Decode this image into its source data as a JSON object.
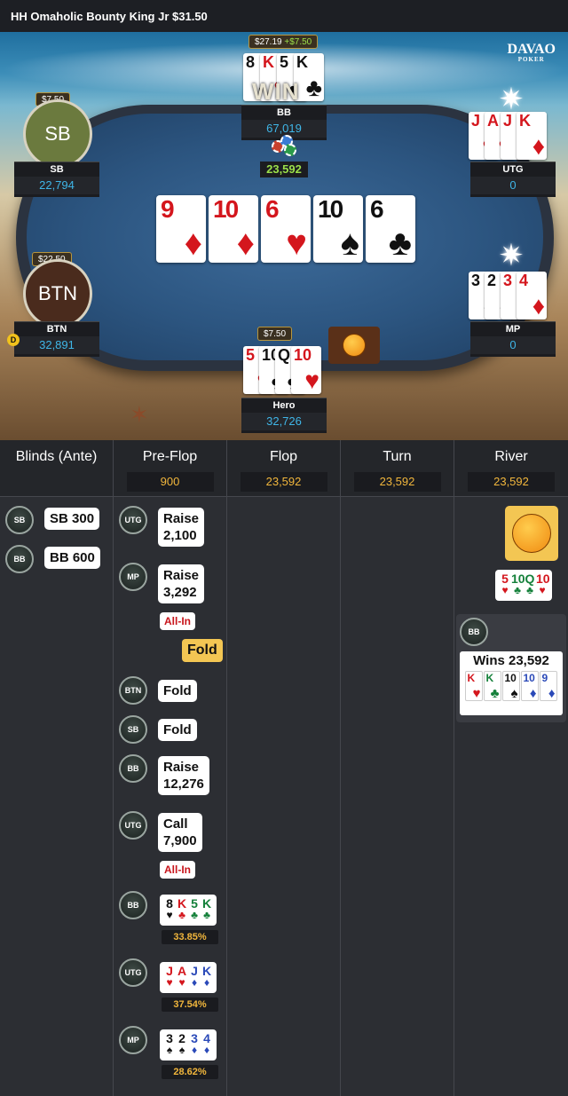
{
  "header": {
    "title": "HH  Omaholic Bounty King Jr $31.50"
  },
  "logo": {
    "name": "DAVAO",
    "sub": "POKER"
  },
  "table": {
    "pot": "23,592",
    "win_label": "WIN",
    "board": [
      {
        "rank": "9",
        "suit": "♦",
        "color": "red"
      },
      {
        "rank": "10",
        "suit": "♦",
        "color": "red"
      },
      {
        "rank": "6",
        "suit": "♥",
        "color": "red"
      },
      {
        "rank": "10",
        "suit": "♠",
        "color": "blk"
      },
      {
        "rank": "6",
        "suit": "♣",
        "color": "blk"
      }
    ],
    "dealer": "D"
  },
  "players": {
    "sb": {
      "avatar": "SB",
      "name": "SB",
      "stack": "22,794",
      "bounty": "$7.50"
    },
    "btn": {
      "avatar": "BTN",
      "name": "BTN",
      "stack": "32,891",
      "bounty": "$22.50"
    },
    "bb": {
      "name": "BB",
      "stack": "67,019",
      "bounty": "$27.19",
      "bounty_gain": "+$7.50",
      "cards": [
        {
          "rank": "8",
          "suit": "♠",
          "color": "blk"
        },
        {
          "rank": "K",
          "suit": "♥",
          "color": "red"
        },
        {
          "rank": "5",
          "suit": "♣",
          "color": "blk"
        },
        {
          "rank": "K",
          "suit": "♣",
          "color": "blk"
        }
      ]
    },
    "utg": {
      "name": "UTG",
      "stack": "0",
      "cards": [
        {
          "rank": "J",
          "suit": "♥",
          "color": "red"
        },
        {
          "rank": "A",
          "suit": "♥",
          "color": "red"
        },
        {
          "rank": "J",
          "suit": "♦",
          "color": "red"
        },
        {
          "rank": "K",
          "suit": "♦",
          "color": "red"
        }
      ]
    },
    "mp": {
      "name": "MP",
      "stack": "0",
      "cards": [
        {
          "rank": "3",
          "suit": "♠",
          "color": "blk"
        },
        {
          "rank": "2",
          "suit": "♠",
          "color": "blk"
        },
        {
          "rank": "3",
          "suit": "♦",
          "color": "red"
        },
        {
          "rank": "4",
          "suit": "♦",
          "color": "red"
        }
      ]
    },
    "hero": {
      "name": "Hero",
      "stack": "32,726",
      "bounty": "$7.50",
      "cards": [
        {
          "rank": "5",
          "suit": "♥",
          "color": "red"
        },
        {
          "rank": "10",
          "suit": "♣",
          "color": "blk"
        },
        {
          "rank": "Q",
          "suit": "♣",
          "color": "blk"
        },
        {
          "rank": "10",
          "suit": "♥",
          "color": "red"
        }
      ]
    }
  },
  "log": {
    "columns": [
      {
        "title": "Blinds (Ante)",
        "value": ""
      },
      {
        "title": "Pre-Flop",
        "value": "900"
      },
      {
        "title": "Flop",
        "value": "23,592"
      },
      {
        "title": "Turn",
        "value": "23,592"
      },
      {
        "title": "River",
        "value": "23,592"
      }
    ],
    "blinds": [
      {
        "chip": "SB",
        "text": "SB 300"
      },
      {
        "chip": "BB",
        "text": "BB 600"
      }
    ],
    "preflop": [
      {
        "chip": "UTG",
        "line1": "Raise",
        "line2": "2,100"
      },
      {
        "chip": "MP",
        "line1": "Raise",
        "line2": "3,292",
        "allin": "All-In"
      },
      {
        "hero_action": "Fold"
      },
      {
        "chip": "BTN",
        "line1": "Fold"
      },
      {
        "chip": "SB",
        "line1": "Fold"
      },
      {
        "chip": "BB",
        "line1": "Raise",
        "line2": "12,276"
      },
      {
        "chip": "UTG",
        "line1": "Call",
        "line2": "7,900",
        "allin": "All-In"
      }
    ],
    "showdown": [
      {
        "chip": "BB",
        "cards": [
          {
            "r": "8",
            "s": "♥",
            "c": "blk"
          },
          {
            "r": "K",
            "s": "♣",
            "c": "red"
          },
          {
            "r": "5",
            "s": "♣",
            "c": "grn"
          },
          {
            "r": "K",
            "s": "♣",
            "c": "grn"
          }
        ],
        "pct": "33.85%"
      },
      {
        "chip": "UTG",
        "cards": [
          {
            "r": "J",
            "s": "♥",
            "c": "red"
          },
          {
            "r": "A",
            "s": "♥",
            "c": "red"
          },
          {
            "r": "J",
            "s": "♦",
            "c": "blu"
          },
          {
            "r": "K",
            "s": "♦",
            "c": "blu"
          }
        ],
        "pct": "37.54%"
      },
      {
        "chip": "MP",
        "cards": [
          {
            "r": "3",
            "s": "♠",
            "c": "blk"
          },
          {
            "r": "2",
            "s": "♠",
            "c": "blk"
          },
          {
            "r": "3",
            "s": "♦",
            "c": "blu"
          },
          {
            "r": "4",
            "s": "♦",
            "c": "blu"
          }
        ],
        "pct": "28.62%"
      }
    ],
    "river": {
      "hero_cards": [
        {
          "r": "5",
          "s": "♥",
          "c": "red"
        },
        {
          "r": "10",
          "s": "♣",
          "c": "grn"
        },
        {
          "r": "Q",
          "s": "♣",
          "c": "grn"
        },
        {
          "r": "10",
          "s": "♥",
          "c": "red"
        }
      ],
      "winner_chip": "BB",
      "wins_text": "Wins 23,592",
      "win_cards": [
        {
          "r": "K",
          "s": "♥",
          "c": "red"
        },
        {
          "r": "K",
          "s": "♣",
          "c": "grn"
        },
        {
          "r": "10",
          "s": "♠",
          "c": "blk"
        },
        {
          "r": "10",
          "s": "♦",
          "c": "blu"
        },
        {
          "r": "9",
          "s": "♦",
          "c": "blu"
        }
      ]
    }
  },
  "colors": {
    "pot_green": "#9be04a",
    "stack_blue": "#3fb6e8",
    "pot_gold": "#f1b63c",
    "allin_red": "#c8151c"
  }
}
